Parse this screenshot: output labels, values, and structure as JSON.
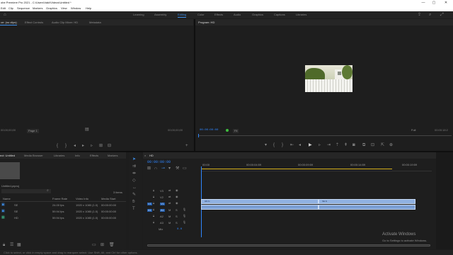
{
  "titlebar": {
    "title": "obe Premiere Pro 2021 - C:\\Users\\Vaki\\Videos\\Untitled *",
    "min": "—",
    "max": "▢",
    "close": "✕"
  },
  "menu": [
    "Edit",
    "Clip",
    "Sequence",
    "Markers",
    "Graphics",
    "View",
    "Window",
    "Help"
  ],
  "workspaces": [
    "Learning",
    "Assembly",
    "Editing",
    "Color",
    "Effects",
    "Audio",
    "Graphics",
    "Captions",
    "Libraries"
  ],
  "source": {
    "tabs": [
      "ce: (no clips)",
      "Effect Controls",
      "Audio Clip Mixer: HD",
      "Metadata"
    ],
    "tc_left": "00;00;00;00",
    "page": "Page 1",
    "tc_right": "00;00;00;00"
  },
  "program": {
    "title": "Program: HD",
    "timecode": "00:00:00:00",
    "zoom": "Fit",
    "resolution": "Full",
    "duration": "00:00:18:2"
  },
  "project": {
    "tabs": [
      "ect: Untitled",
      "Media Browser",
      "Libraries",
      "Info",
      "Effects",
      "Markers"
    ],
    "filename": "Untitled.prproj",
    "count": "3 items",
    "columns": [
      "Name",
      "Frame Rate",
      "Video Info",
      "Media Start"
    ],
    "rows": [
      {
        "name": "SE",
        "fps": "24.00 fps",
        "info": "1920 x 1080 (1.0)",
        "start": "00:00:00:00"
      },
      {
        "name": "SE",
        "fps": "59.94 fps",
        "info": "1920 x 1080 (1.0)",
        "start": "00:00:00:00"
      },
      {
        "name": "HD",
        "fps": "59.94 fps",
        "info": "1920 x 1080 (1.0)",
        "start": "00:00:00:00"
      }
    ]
  },
  "timeline": {
    "seq_tab": "HD",
    "timecode": "00:00:00:00",
    "ruler": [
      "00:00",
      "00:00:04:59",
      "00:00:09:59",
      "00:00:14:59",
      "00:00:19:59"
    ],
    "tracks_video": [
      "V3",
      "V2",
      "V1"
    ],
    "tracks_audio": [
      "A1",
      "A2",
      "A3"
    ],
    "mix_label": "Mix",
    "mix_value": "0.0",
    "clips": [
      {
        "label": "HD.fx",
        "start": 0.0,
        "end": 0.51
      },
      {
        "label": "SE.fx",
        "start": 0.51,
        "end": 0.93
      }
    ],
    "playhead": 0.0
  },
  "watermark": {
    "line1": "Activate Windows",
    "line2": "Go to Settings to activate Windows."
  },
  "status": "Click to select, or click in empty space and drag to marquee select. Use Shift, Alt, and Ctrl for other options.",
  "colors": {
    "accent": "#2f86ff",
    "clip_video": "#8fb0e0",
    "clip_audio": "#7b9fd4",
    "workarea": "#d6b01c"
  }
}
